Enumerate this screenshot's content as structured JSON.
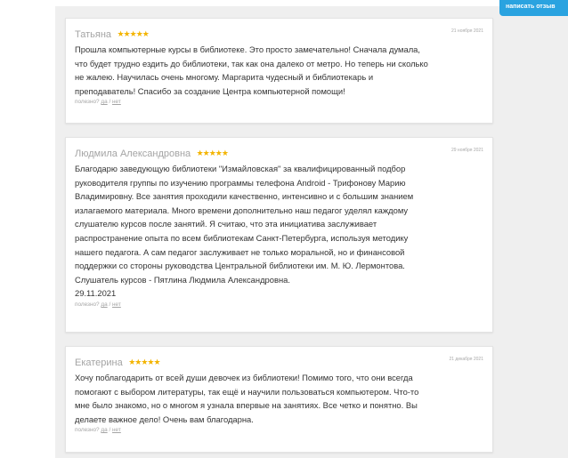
{
  "write_review_label": "написать отзыв",
  "helpful": {
    "question": "полезно?",
    "yes": "да",
    "separator": "/",
    "no": "нет"
  },
  "colors": {
    "accent": "#2aa3e0",
    "stars": "#f3b400",
    "background": "#efefef"
  },
  "reviews": [
    {
      "author": "Татьяна",
      "stars": "★★★★★",
      "date": "21 ноября 2021",
      "text": "Прошла компьютерные курсы в библиотеке. Это просто замечательно! Сначала думала,\nчто будет трудно ездить до библиотеки, так как она далеко от метро. Но теперь ни сколько\nне жалею. Научилась очень многому. Маргарита чудесный и библиотекарь и\nпреподаватель! Спасибо за создание Центра компьютерной помощи!"
    },
    {
      "author": "Людмила Александровна",
      "stars": "★★★★★",
      "date": "29 ноября 2021",
      "text": "Благодарю заведующую библиотеки \"Измайловская\" за квалифицированный подбор\nруководителя группы по изучению программы телефона Android - Трифонову Марию\nВладимировну. Все занятия проходили качественно, интенсивно и с большим знанием\nизлагаемого материала. Много времени дополнительно наш педагог уделял каждому\nслушателю курсов после занятий. Я считаю, что эта инициатива заслуживает\nраспространение опыта по всем библиотекам Санкт-Петербурга, используя методику\nнашего педагога. А сам педагог заслуживает не только моральной, но и финансовой\nподдержки со стороны руководства Центральной библиотеки им. М. Ю. Лермонтова.\nСлушатель курсов - Пятлина Людмила Александровна.\n29.11.2021"
    },
    {
      "author": "Екатерина",
      "stars": "★★★★★",
      "date": "21 декабря 2021",
      "text": "Хочу поблагодарить от всей души девочек из библиотеки! Помимо того, что они всегда\nпомогают с выбором литературы, так ещё и научили пользоваться компьютером. Что-то\nмне было знакомо, но о многом я узнала впервые на занятиях. Все четко и понятно. Вы\nделаете важное дело! Очень вам благодарна."
    }
  ]
}
